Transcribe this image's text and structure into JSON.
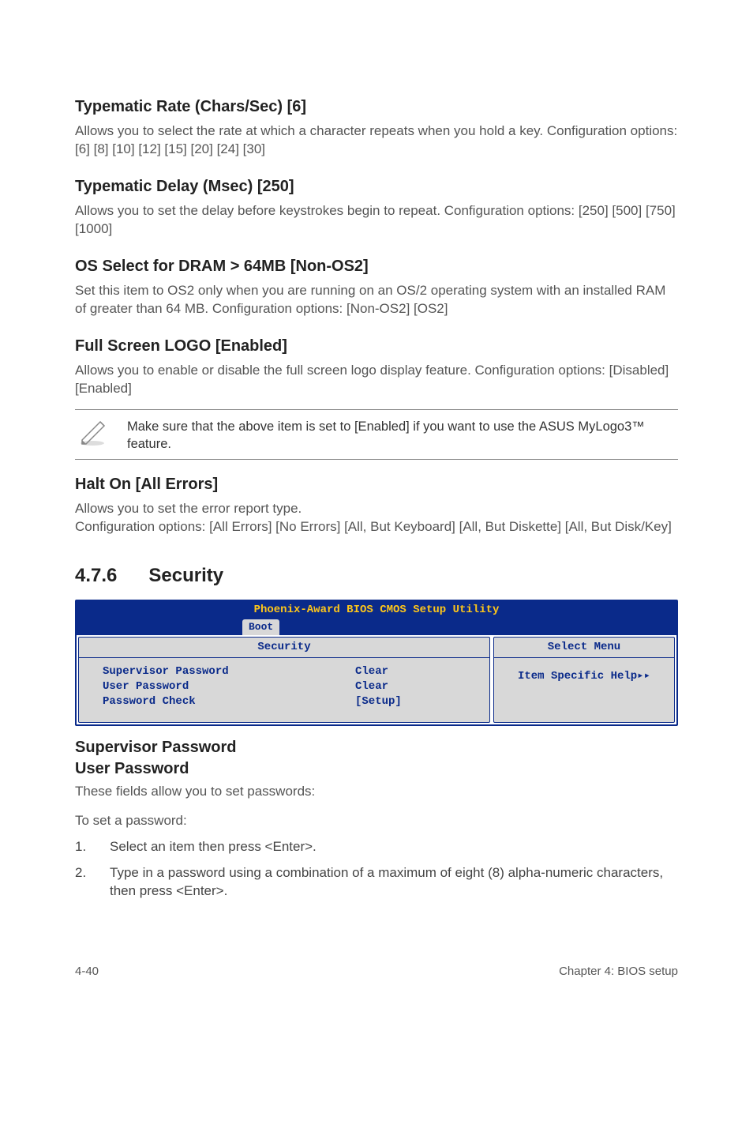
{
  "sections": {
    "typematic_rate": {
      "title": "Typematic Rate (Chars/Sec) [6]",
      "desc": "Allows you to select the rate at which a character repeats when you hold a key. Configuration options: [6] [8] [10] [12] [15] [20] [24] [30]"
    },
    "typematic_delay": {
      "title": "Typematic Delay (Msec) [250]",
      "desc": "Allows you to set the delay before keystrokes begin to repeat. Configuration options: [250] [500] [750] [1000]"
    },
    "os_select": {
      "title": "OS Select for DRAM > 64MB [Non-OS2]",
      "desc": "Set this item to OS2 only when you are running on an OS/2 operating system with an installed RAM of greater than 64 MB. Configuration options: [Non-OS2] [OS2]"
    },
    "full_logo": {
      "title": "Full Screen LOGO [Enabled]",
      "desc": "Allows you to enable or disable the full screen logo display feature. Configuration options: [Disabled] [Enabled]"
    },
    "note": {
      "text": "Make sure that the above item is set to [Enabled] if you want to use the ASUS MyLogo3™ feature."
    },
    "halt_on": {
      "title": "Halt On [All Errors]",
      "desc": "Allows you to set the error report type.\nConfiguration options: [All Errors] [No Errors] [All, But Keyboard] [All, But Diskette] [All, But Disk/Key]"
    },
    "security_section": {
      "number": "4.7.6",
      "title": "Security"
    },
    "bios": {
      "title": "Phoenix-Award BIOS CMOS Setup Utility",
      "tab": "Boot",
      "left_title": "Security",
      "right_title": "Select Menu",
      "help": "Item Specific Help▸▸",
      "rows": [
        {
          "label": "Supervisor Password",
          "value": "Clear"
        },
        {
          "label": "User Password",
          "value": "Clear"
        },
        {
          "label": "Password Check",
          "value": "[Setup]"
        }
      ]
    },
    "password_sub": {
      "h1": "Supervisor Password",
      "h2": "User Password",
      "intro": "These fields allow you to set passwords:",
      "to_set": "To set a password:",
      "steps": [
        "Select an item then press <Enter>.",
        "Type in a password using a combination of a maximum of eight (8) alpha-numeric characters, then press <Enter>."
      ]
    }
  },
  "footer": {
    "left": "4-40",
    "right": "Chapter 4: BIOS setup"
  }
}
